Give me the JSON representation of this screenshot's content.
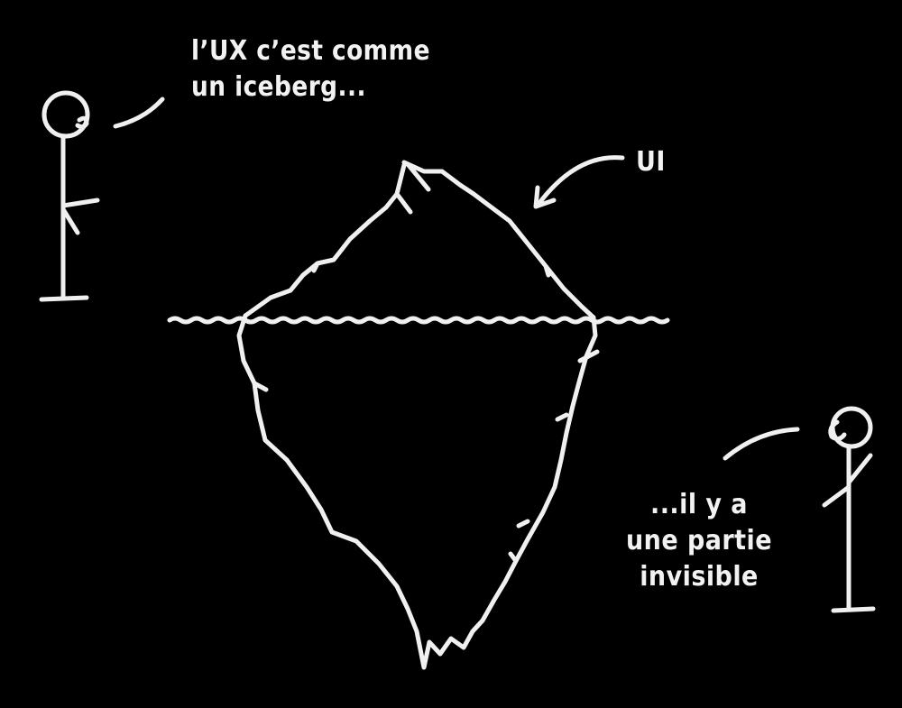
{
  "colors": {
    "background": "#000000",
    "chalk": "#f0f0f0"
  },
  "texts": {
    "left_quote": [
      "l’UX c’est comme",
      "un iceberg..."
    ],
    "ui_label": "UI",
    "right_quote": [
      "...il y a",
      "une partie",
      "invisible"
    ]
  }
}
